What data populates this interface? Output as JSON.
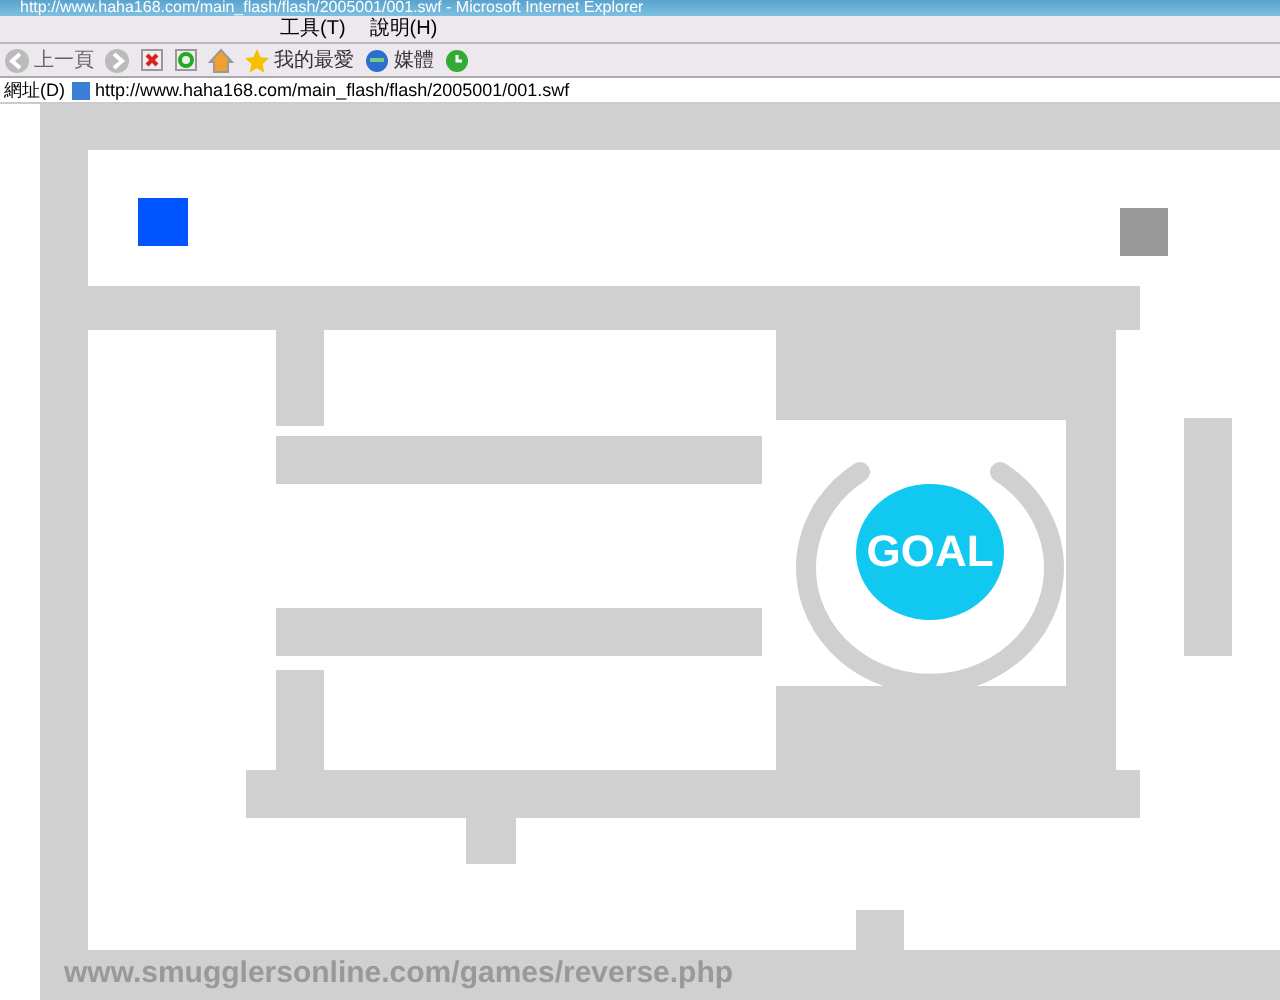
{
  "window": {
    "title": "http://www.haha168.com/main_flash/flash/2005001/001.swf - Microsoft Internet Explorer"
  },
  "menu": [
    "工具(T)",
    "說明(H)"
  ],
  "toolbar": {
    "back": "上一頁",
    "favorites": "我的最愛",
    "media": "媒體"
  },
  "address_bar": {
    "label": "網址(D)",
    "value": "http://www.haha168.com/main_flash/flash/2005001/001.swf"
  },
  "game": {
    "goal": "GOAL",
    "footer": "www.smugglersonline.com/games/reverse.php"
  }
}
